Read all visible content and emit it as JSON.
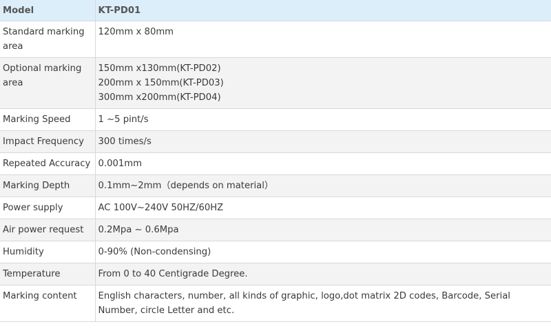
{
  "header": {
    "label": "Model",
    "value": "KT-PD01"
  },
  "rows": [
    {
      "label": "Standard marking area",
      "lines": [
        "120mm x 80mm"
      ]
    },
    {
      "label": "Optional marking area",
      "lines": [
        "150mm x130mm(KT-PD02)",
        "200mm x 150mm(KT-PD03)",
        "300mm x200mm(KT-PD04)"
      ]
    },
    {
      "label": "Marking Speed",
      "lines": [
        "1 ~5 pint/s"
      ]
    },
    {
      "label": "Impact Frequency",
      "lines": [
        "300 times/s"
      ]
    },
    {
      "label": "Repeated Accuracy",
      "lines": [
        "0.001mm"
      ]
    },
    {
      "label": "Marking Depth",
      "lines": [
        "0.1mm~2mm（depends on material）"
      ]
    },
    {
      "label": "Power supply",
      "lines": [
        "AC 100V~240V 50HZ/60HZ"
      ]
    },
    {
      "label": "Air power request",
      "lines": [
        "0.2Mpa ~ 0.6Mpa"
      ]
    },
    {
      "label": "Humidity",
      "lines": [
        "0-90% (Non-condensing)"
      ]
    },
    {
      "label": "Temperature",
      "lines": [
        "From 0 to 40 Centigrade Degree."
      ]
    },
    {
      "label": "Marking content",
      "lines": [
        "English characters, number, all kinds of graphic, logo,dot matrix 2D codes, Barcode, Serial Number, circle Letter and etc."
      ]
    }
  ],
  "colors": {
    "header_bg": "#dceef9",
    "shaded_row_bg": "#f3f3f3",
    "border": "#d4d9dd",
    "text": "#3a3a3a"
  }
}
